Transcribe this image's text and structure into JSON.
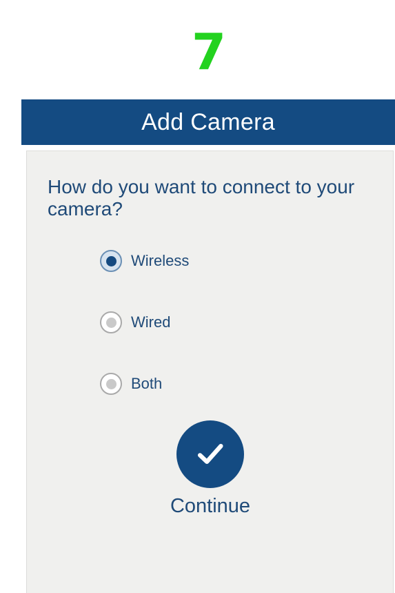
{
  "step": {
    "number": "7",
    "color": "#23d21f"
  },
  "header": {
    "title": "Add Camera",
    "background": "#144b82"
  },
  "dialog": {
    "question": "How do you want to connect to your camera?",
    "options": [
      {
        "label": "Wireless",
        "selected": true
      },
      {
        "label": "Wired",
        "selected": false
      },
      {
        "label": "Both",
        "selected": false
      }
    ],
    "continue": {
      "label": "Continue",
      "icon": "checkmark-icon",
      "color": "#144b82"
    },
    "accent_color": "#1f4a78"
  }
}
